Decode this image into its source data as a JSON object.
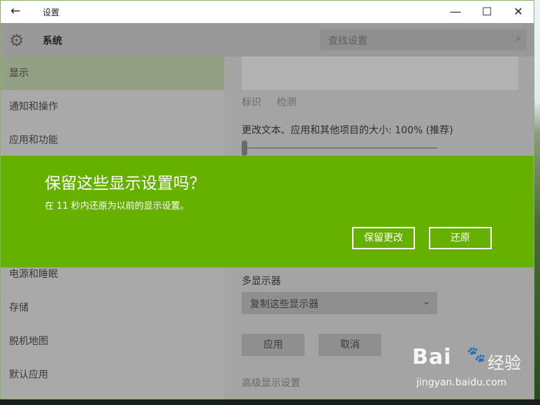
{
  "window": {
    "title": "设置"
  },
  "titlebar": {
    "back_icon": "←",
    "minimize_icon": "—",
    "maximize_icon": "☐",
    "close_icon": "✕"
  },
  "header": {
    "section_title": "系统",
    "gear_icon": "⚙",
    "search_placeholder": "查找设置",
    "search_icon": "⌕"
  },
  "sidebar": {
    "items": [
      {
        "label": "显示",
        "selected": true
      },
      {
        "label": "通知和操作"
      },
      {
        "label": "应用和功能"
      },
      {
        "label": "电源和睡眠"
      },
      {
        "label": "存储"
      },
      {
        "label": "脱机地图"
      },
      {
        "label": "默认应用"
      }
    ]
  },
  "main": {
    "identify_link": "标识",
    "detect_link": "检测",
    "scale_label": "更改文本、应用和其他项目的大小: 100% (推荐)",
    "scale_percent": 100,
    "multi_display_label": "多显示器",
    "multi_display_value": "复制这些显示器",
    "apply_button": "应用",
    "cancel_button": "取消",
    "advanced_link": "高级显示设置"
  },
  "dialog": {
    "title": "保留这些显示设置吗？",
    "message": "在 11 秒内还原为以前的显示设置。",
    "keep_button": "保留更改",
    "revert_button": "还原"
  },
  "watermark": {
    "logo": "Bai",
    "paw": "🐾",
    "jingyan": "经验",
    "url": "jingyan.baidu.com"
  },
  "colors": {
    "accent": "#66b000",
    "dim_bg": "#a4a4a4",
    "selected_nav": "#93a083"
  }
}
